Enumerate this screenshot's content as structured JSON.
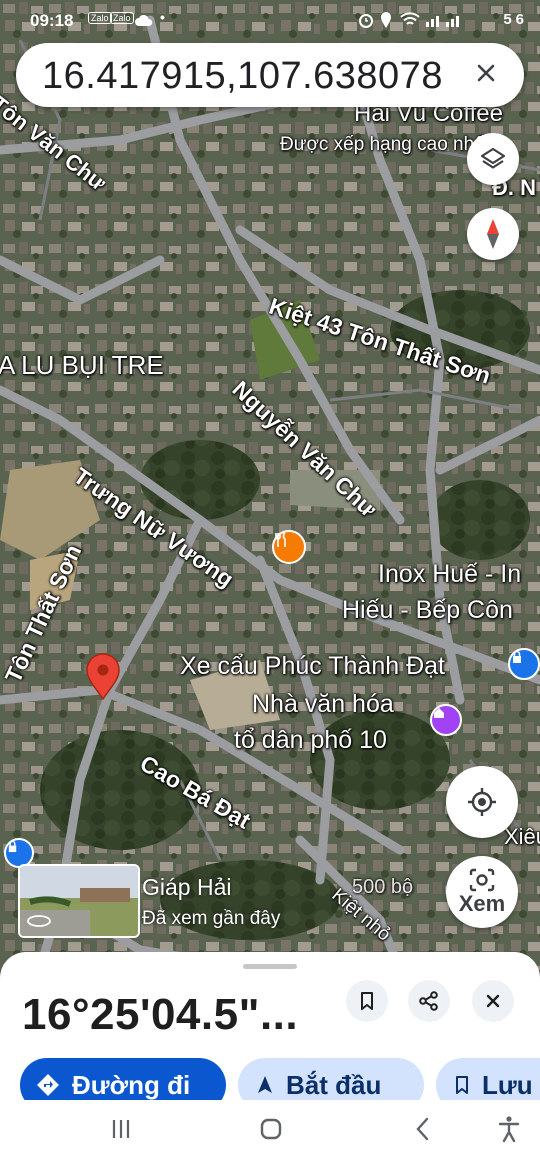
{
  "status_bar": {
    "time": "09:18",
    "noti1": "Zalo",
    "noti2": "Zalo",
    "battery": "56"
  },
  "search": {
    "query": "16.417915,107.638078"
  },
  "map_labels": {
    "hai_vu_coffee": "Hải Vũ Coffee",
    "hai_vu_rating": "Được xếp hạng cao nhất",
    "road_top_left": "Tôn Văn Chư",
    "road_top_right": "Đ. N",
    "road_top_right2": "Nguyễ",
    "kiet43": "Kiệt 43 Tôn Thất Sơn",
    "lu_bui_tre": "A LU BỤI TRE",
    "nguyen_van_chu": "Nguyễn Văn Chư",
    "trung_nu_vuong": "Trưng Nữ Vương",
    "inox_hue_1": "Inox Huế - In",
    "inox_hue_2": "Hiếu - Bếp Côn",
    "xe_cau": "Xe cẩu Phúc Thành Đạt",
    "nha_van_hoa_1": "Nhà văn hóa",
    "nha_van_hoa_2": "tổ dân phố 10",
    "ton_that_son": "Tôn Thất Sơn",
    "cao_ba_dat": "Cao Bá Đạt",
    "xieu": "Xiêu",
    "kiet_nho": "Kiệt nhỏ",
    "scale": "500 bộ"
  },
  "street_view": {
    "title": "Giáp Hải",
    "subtitle": "Đã xem gần đây"
  },
  "buttons": {
    "lens_label": "Xem"
  },
  "sheet": {
    "title": "16°25'04.5\"...",
    "directions_label": "Đường đi",
    "start_label": "Bắt đầu",
    "save_label": "Lưu"
  },
  "colors": {
    "primary_blue": "#0b57d0",
    "chip_light_blue": "#d3e3fd",
    "pin_red": "#ea4335",
    "restaurant_orange": "#f57c00",
    "place_purple": "#a142f4"
  },
  "icons": {
    "close": "close-icon",
    "layers": "layers-icon",
    "compass": "compass-icon",
    "my_location": "my-location-icon",
    "lens": "lens-icon",
    "save": "bookmark-icon",
    "share": "share-icon",
    "directions": "directions-icon",
    "navigate": "navigation-arrow-icon",
    "recent_apps": "recent-apps-icon",
    "home": "home-icon",
    "back": "back-icon",
    "accessibility": "accessibility-icon"
  }
}
